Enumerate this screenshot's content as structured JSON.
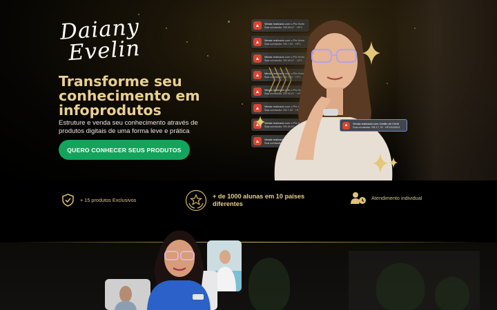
{
  "brand": {
    "signature_line1": "Daiany",
    "signature_line2": "Evelin"
  },
  "hero": {
    "headline": "Transforme seu conhecimento em infoprodutos",
    "subtitle": "Estruture e venda seu conhecimento através de produtos digitais de uma forma leve e prática",
    "cta_label": "QUERO CONHECER SEUS PRODUTOS"
  },
  "notifications": [
    {
      "title": "Venda realizada com o Pix Hotm",
      "detail": "Sua comissão: R$ 69,67 · HP1"
    },
    {
      "title": "Venda realizada com o Pix Hotm",
      "detail": "Sua comissão: R$ 7,50 · HP1"
    },
    {
      "title": "Venda realizada com o Pix Hotm",
      "detail": "Sua comissão: R$ 69,67 · HP1"
    },
    {
      "title": "Venda realizada com o Pix Hotm",
      "detail": "Sua comissão: R$ 7,50 · HP1"
    },
    {
      "title": "Venda realizada com o Pix Hotm",
      "detail": "Sua comissão: R$ 69,67 · HP1"
    },
    {
      "title": "Venda realizada com o Pix Hotm",
      "detail": "Sua comissão: R$ 7,50 · HP1"
    },
    {
      "title": "Venda realizada com o Pix Hotm",
      "detail": "Sua comissão: R$ 69,67 · HP1"
    },
    {
      "title": "Venda realizada com o Pix Hotm",
      "detail": "Sua comissão: R$ 7,50 · HP1"
    }
  ],
  "side_notification": {
    "title": "Venda realizada com Cartão de Crédi",
    "detail": "Sua comissão: R$ 17,76 · HP1034813"
  },
  "features": {
    "products": "+ 15 produtos Exclusivos",
    "students": "+ de 1000 alunas em 10 países diferentes",
    "support": "Atendimento individual"
  },
  "colors": {
    "gold": "#e9cf91",
    "cta_green": "#12a45c",
    "notification_red": "#d8452f"
  },
  "icons": {
    "products": "shield-check-icon",
    "students": "laurel-star-icon",
    "support": "user-clock-icon",
    "notification": "hotmart-flame-icon"
  }
}
